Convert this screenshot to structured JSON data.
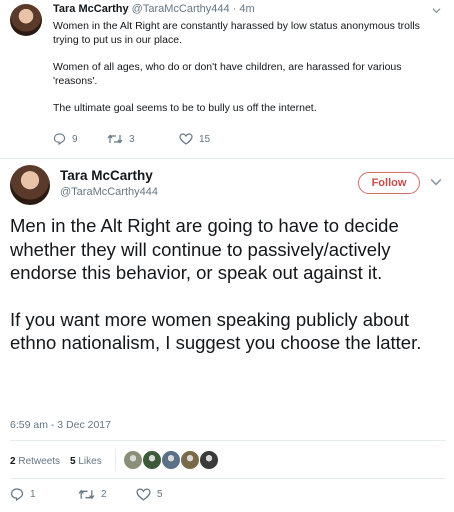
{
  "reply_context_tweet": {
    "author_name": "Tara McCarthy",
    "handle_and_time": "@TaraMcCarthy444 · 4m",
    "paragraphs": [
      "Women in the Alt Right are constantly harassed by low status anonymous trolls trying to put us in our place.",
      "Women of all ages, who do or don't have children, are harassed for various 'reasons'.",
      "The ultimate goal seems to be to bully us off the internet."
    ],
    "actions": {
      "replies": "9",
      "retweets": "3",
      "likes": "15"
    }
  },
  "main_tweet": {
    "author_name": "Tara McCarthy",
    "handle": "@TaraMcCarthy444",
    "follow_label": "Follow",
    "paragraphs": [
      "Men in the Alt Right are going to have to decide whether they will continue to passively/actively endorse this behavior, or speak out against it.",
      "If you want more women speaking publicly about ethno nationalism, I suggest you choose the latter."
    ],
    "timestamp": "6:59 am - 3 Dec 2017",
    "stats": {
      "retweets_count": "2",
      "retweets_label": "Retweets",
      "likes_count": "5",
      "likes_label": "Likes"
    },
    "liker_avatar_colors": [
      "#8a8f7a",
      "#3c5a3a",
      "#5b6f86",
      "#7a6a4a",
      "#3a3a3a"
    ],
    "actions": {
      "replies": "1",
      "retweets": "2",
      "likes": "5"
    }
  },
  "colors": {
    "follow_accent": "#c94a4a",
    "secondary_text": "#657786",
    "divider": "#e6ecf0"
  },
  "icons": [
    "reply-icon",
    "retweet-icon",
    "like-icon",
    "chevron-down-icon"
  ]
}
